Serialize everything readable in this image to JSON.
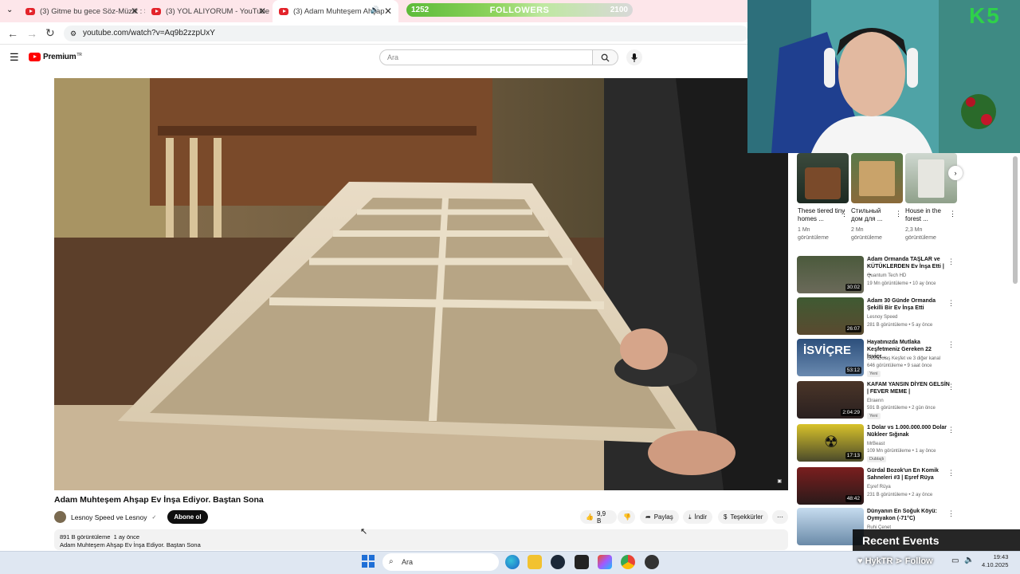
{
  "browser": {
    "tabs": [
      {
        "title": "(3) Gitme bu gece Söz-Müzik : S"
      },
      {
        "title": "(3) YOL ALIYORUM - YouTube"
      },
      {
        "title": "(3) Adam Muhteşem Ahşap",
        "active": true
      }
    ],
    "url": "youtube.com/watch?v=Aq9b2zzpUxY"
  },
  "overlay": {
    "followers_current": "1252",
    "followers_label": "FOLLOWERS",
    "followers_goal": "2100",
    "webcam_brand": "K5",
    "recent_events": "Recent Events",
    "follow_ticker": "HykTR ⋗ Follow"
  },
  "youtube": {
    "logo_text": "Premium",
    "logo_region": "TR",
    "search_placeholder": "Ara",
    "video": {
      "title": "Adam Muhteşem Ahşap Ev İnşa Ediyor. Baştan Sona",
      "channel": "Lesnoy Speed ve Lesnoy",
      "subscribe": "Abone ol",
      "likes": "9,9 B",
      "share": "Paylaş",
      "download": "İndir",
      "thanks": "Teşekkürler",
      "views": "891 B görüntüleme",
      "age": "1 ay önce",
      "desc_line": "Adam Muhteşem Ahşap Ev İnşa Ediyor. Baştan Sona"
    },
    "shorts": [
      {
        "title": "These tiered tiny homes ...",
        "views": "1 Mn görüntüleme"
      },
      {
        "title": "Стильный дом для ...",
        "views": "2 Mn görüntüleme"
      },
      {
        "title": "House in the forest ...",
        "views": "2,3 Mn görüntüleme"
      }
    ],
    "recommended": [
      {
        "title": "Adam Ormanda TAŞLAR ve KÜTÜKLERDEN Ev İnşa Etti | ...",
        "channel": "Quantum Tech HD",
        "meta": "19 Mn görüntüleme • 10 ay önce",
        "duration": "30:02",
        "badge": ""
      },
      {
        "title": "Adam 30 Günde Ormanda Şekilli Bir Ev İnşa Etti",
        "channel": "Lesnoy Speed",
        "meta": "281 B görüntüleme • 5 ay önce",
        "duration": "26:07",
        "badge": ""
      },
      {
        "title": "Hayatınızda Mutlaka Keşfetmeniz Gereken 22 İsviçr...",
        "channel": "Gezi Dolaş Keşfet ve 3 diğer kanal",
        "meta": "646 görüntüleme • 9 saat önce",
        "duration": "53:12",
        "badge": "Yeni"
      },
      {
        "title": "KAFAM YANSIN DİYEN GELSİN | FEVER MEME |",
        "channel": "Elraenn",
        "meta": "591 B görüntüleme • 2 gün önce",
        "duration": "2:04:29",
        "badge": "Yeni"
      },
      {
        "title": "1 Dolar vs 1.000.000.000 Dolar Nükleer Sığınak",
        "channel": "MrBeast",
        "meta": "109 Mn görüntüleme • 1 ay önce",
        "duration": "17:13",
        "badge": "Dublajlı"
      },
      {
        "title": "Gürdal Bozok'un En Komik Sahneleri #3 | Eşref Rüya",
        "channel": "Eşref Rüya",
        "meta": "231 B görüntüleme • 2 ay önce",
        "duration": "48:42",
        "badge": ""
      },
      {
        "title": "Dünyanın En Soğuk Köyü: Oymyakon (-71°C)",
        "channel": "Ruhi Çenet",
        "meta": "",
        "duration": "",
        "badge": ""
      }
    ]
  },
  "taskbar": {
    "search_placeholder": "Ara",
    "time": "19:43",
    "date": "4.10.2025"
  }
}
